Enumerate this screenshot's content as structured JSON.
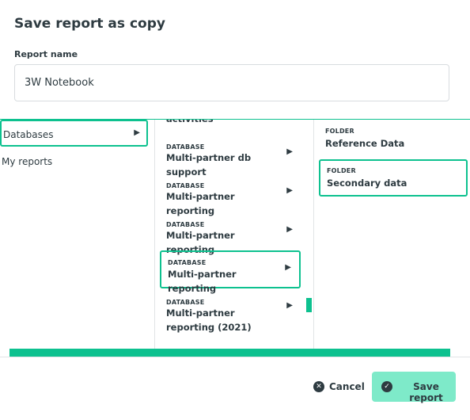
{
  "dialog": {
    "title": "Save report as copy"
  },
  "report_name": {
    "label": "Report name",
    "value": "3W Notebook"
  },
  "column1": {
    "items": [
      {
        "label": "Databases",
        "arrow": "▶",
        "selected": true
      },
      {
        "label": "My reports",
        "selected": false
      }
    ]
  },
  "column2": {
    "partial_item_label": "activities",
    "items": [
      {
        "type": "DATABASE",
        "name": "Multi-partner db support",
        "arrow": "▶",
        "selected": false
      },
      {
        "type": "DATABASE",
        "name": "Multi-partner reporting",
        "arrow": "▶",
        "selected": false
      },
      {
        "type": "DATABASE",
        "name": "Multi-partner reporting",
        "arrow": "▶",
        "selected": false
      },
      {
        "type": "DATABASE",
        "name": "Multi-partner reporting",
        "arrow": "▶",
        "selected": true
      },
      {
        "type": "DATABASE",
        "name": "Multi-partner reporting (2021)",
        "arrow": "▶",
        "selected": false
      }
    ]
  },
  "column3": {
    "items": [
      {
        "type": "FOLDER",
        "name": "Reference Data",
        "selected": false
      },
      {
        "type": "FOLDER",
        "name": "Secondary data",
        "selected": true
      }
    ]
  },
  "footer": {
    "cancel_label": "Cancel",
    "cancel_icon": "✕",
    "save_label": "Save report",
    "save_icon": "✓"
  },
  "colors": {
    "accent": "#0dc18f",
    "primary_button": "#7eeac9",
    "text": "#2e3b41"
  }
}
